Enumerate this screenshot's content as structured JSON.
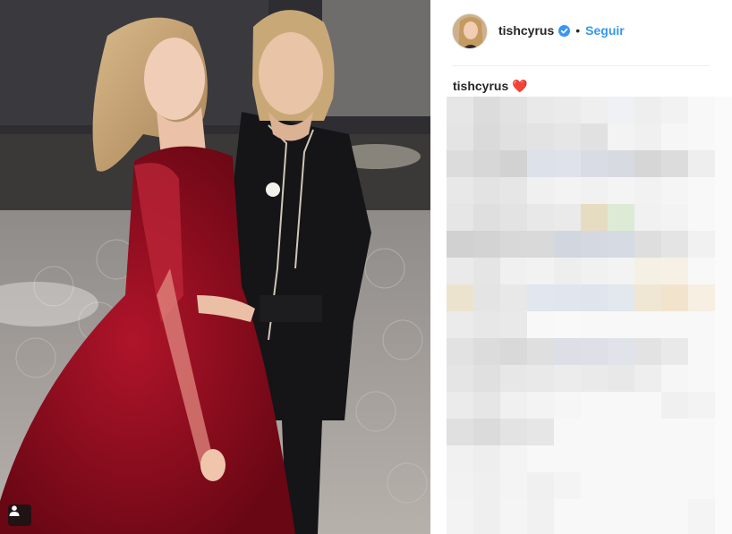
{
  "header": {
    "username": "tishcyrus",
    "separator": "•",
    "follow_label": "Seguir"
  },
  "caption": {
    "username": "tishcyrus",
    "emoji": "❤️"
  },
  "icons": {
    "verified": "verified-badge-icon",
    "tag": "user-tag-icon"
  },
  "colors": {
    "link": "#3897f0",
    "verified": "#3897f0",
    "text": "#262626",
    "divider": "#efefef"
  }
}
